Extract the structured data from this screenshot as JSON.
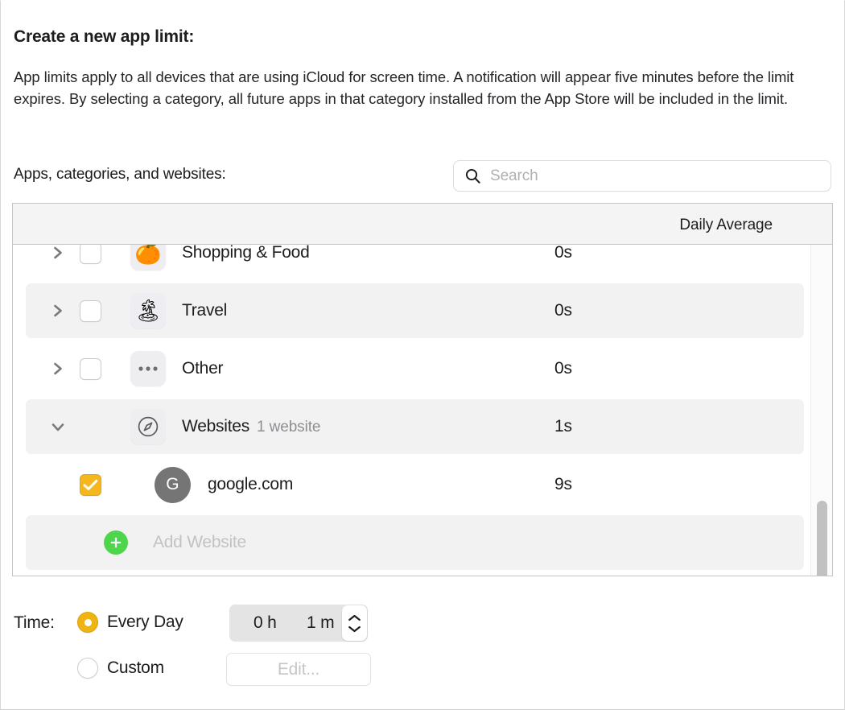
{
  "heading": {
    "title": "Create a new app limit:",
    "description": "App limits apply to all devices that are using iCloud for screen time. A notification will appear five minutes before the limit expires. By selecting a category, all future apps in that category installed from the App Store will be included in the limit."
  },
  "picker": {
    "label": "Apps, categories, and websites:",
    "search_placeholder": "Search",
    "search_value": "",
    "column_header_daily_average": "Daily Average",
    "rows": [
      {
        "label": "Shopping & Food",
        "sub": "",
        "value": "0s",
        "icon": "shopping-food-icon",
        "glyph": "🍊",
        "kind": "category",
        "disclosure": "collapsed",
        "checked": false,
        "striped": false
      },
      {
        "label": "Travel",
        "sub": "",
        "value": "0s",
        "icon": "travel-icon",
        "glyph": "🏝",
        "kind": "category",
        "disclosure": "collapsed",
        "checked": false,
        "striped": true
      },
      {
        "label": "Other",
        "sub": "",
        "value": "0s",
        "icon": "ellipsis-icon",
        "glyph": "",
        "kind": "category",
        "disclosure": "collapsed",
        "checked": false,
        "striped": false
      },
      {
        "label": "Websites",
        "sub": "1 website",
        "value": "1s",
        "icon": "compass-icon",
        "glyph": "",
        "kind": "group",
        "disclosure": "expanded",
        "checked": false,
        "striped": true
      },
      {
        "label": "google.com",
        "sub": "",
        "value": "9s",
        "icon": "site-avatar",
        "glyph": "G",
        "kind": "website",
        "disclosure": "none",
        "checked": true,
        "striped": false
      },
      {
        "label": "Add Website",
        "sub": "",
        "value": "",
        "icon": "plus-circle-icon",
        "glyph": "",
        "kind": "add",
        "disclosure": "none",
        "checked": false,
        "striped": true
      }
    ]
  },
  "time": {
    "label": "Time:",
    "every_day_label": "Every Day",
    "custom_label": "Custom",
    "selected": "every_day",
    "stepper": {
      "hours": "0 h",
      "minutes": "1 m"
    },
    "edit_label": "Edit..."
  },
  "colors": {
    "accent_checkbox": "#f5b81c",
    "accent_radio": "#f0b412",
    "add_plus": "#4ed54b",
    "avatar": "#757575",
    "row_stripe": "#f2f2f2",
    "header_bg": "#f4f4f4",
    "border": "#c4c4c4"
  }
}
